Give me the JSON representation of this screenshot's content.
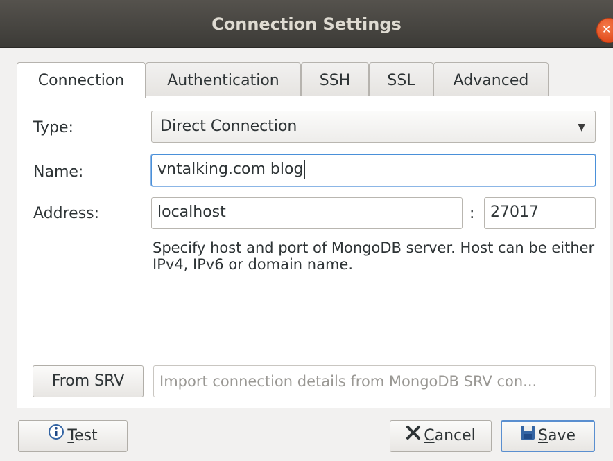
{
  "window": {
    "title": "Connection Settings"
  },
  "tabs": [
    {
      "label": "Connection",
      "active": true
    },
    {
      "label": "Authentication"
    },
    {
      "label": "SSH"
    },
    {
      "label": "SSL"
    },
    {
      "label": "Advanced"
    }
  ],
  "form": {
    "type_label": "Type:",
    "type_value": "Direct Connection",
    "name_label": "Name:",
    "name_value": "vntalking.com blog",
    "address_label": "Address:",
    "host_value": "localhost",
    "port_separator": ":",
    "port_value": "27017",
    "help_text": "Specify host and port of MongoDB server. Host can be either IPv4, IPv6 or domain name."
  },
  "srv": {
    "button_label": "From SRV",
    "placeholder": "Import connection details from MongoDB SRV con..."
  },
  "footer": {
    "test_label": "Test",
    "test_mnemonic": "T",
    "cancel_label": "Cancel",
    "cancel_mnemonic": "C",
    "save_label": "Save",
    "save_mnemonic": "S"
  },
  "icons": {
    "close": "close-icon",
    "dropdown": "chevron-down-icon",
    "test": "info-icon",
    "cancel": "x-icon",
    "save": "floppy-icon"
  },
  "colors": {
    "accent": "#4a90d9",
    "close_button": "#e95420"
  }
}
